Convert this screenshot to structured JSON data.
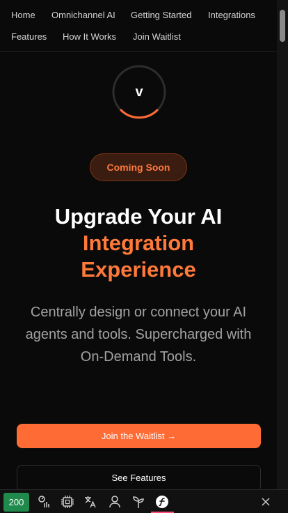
{
  "nav": {
    "items": [
      {
        "label": "Home"
      },
      {
        "label": "Omnichannel AI"
      },
      {
        "label": "Getting Started"
      },
      {
        "label": "Integrations"
      },
      {
        "label": "Features"
      },
      {
        "label": "How It Works"
      },
      {
        "label": "Join Waitlist"
      }
    ]
  },
  "logo": {
    "letter": "v",
    "progress": 0.25
  },
  "badge": {
    "label": "Coming Soon"
  },
  "hero": {
    "line1": "Upgrade Your AI",
    "line2": "Integration",
    "line3": "Experience",
    "subtitle": "Centrally design or connect your AI agents and tools. Supercharged with On-Demand Tools."
  },
  "cta": {
    "primary": "Join the Waitlist →",
    "secondary": "See Features"
  },
  "devbar": {
    "status_code": "200",
    "icons": [
      "performance-icon",
      "cpu-icon",
      "translation-icon",
      "user-icon",
      "twig-icon",
      "symfony-icon"
    ]
  },
  "colors": {
    "accent": "#ff6b35",
    "background": "#0a0a0a",
    "status_green": "#1f8a4c"
  }
}
